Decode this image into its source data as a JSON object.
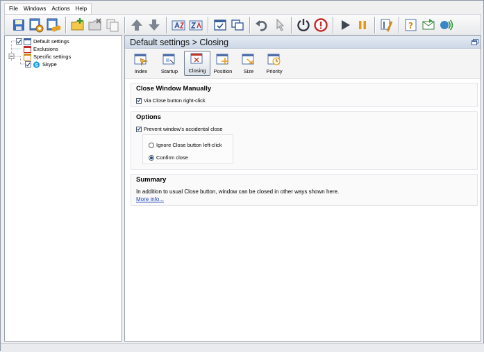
{
  "menu": [
    "File",
    "Windows",
    "Actions",
    "Help"
  ],
  "tree": {
    "items": [
      {
        "label": "Default settings",
        "checked": true
      },
      {
        "label": "Exclusions"
      },
      {
        "label": "Specific settings"
      },
      {
        "label": "Skype",
        "checked": true
      }
    ]
  },
  "pane": {
    "title": "Default settings > Closing",
    "tabs": [
      "Index",
      "Startup",
      "Closing",
      "Position",
      "Size",
      "Priority"
    ],
    "active_tab": "Closing"
  },
  "close_manually": {
    "heading": "Close Window Manually",
    "option_label": "Via Close button right-click",
    "checked": true
  },
  "options": {
    "heading": "Options",
    "prevent_label": "Prevent window's accidental close",
    "prevent_checked": true,
    "radio_ignore": "Ignore Close button left-click",
    "radio_confirm": "Confirm close",
    "selected": "Confirm close"
  },
  "summary": {
    "heading": "Summary",
    "text": "In addition to usual Close button, window can be closed in other ways shown here.",
    "link": "More info..."
  },
  "icons": {
    "toolbar": [
      "save-icon",
      "settings-a-icon",
      "settings-b-icon",
      "add-folder-icon",
      "remove-folder-icon",
      "copy-icon",
      "arrow-up-icon",
      "arrow-down-icon",
      "sort-a-icon",
      "sort-z-icon",
      "check-window-icon",
      "windows-icon",
      "undo-icon",
      "cursor-icon",
      "power-icon",
      "stop-icon",
      "play-icon",
      "pause-icon",
      "tools-icon",
      "help-icon",
      "mail-icon",
      "info-icon"
    ]
  },
  "colors": {
    "accent_link": "#1a3fb8",
    "title_bar": "#cdd8e6"
  }
}
